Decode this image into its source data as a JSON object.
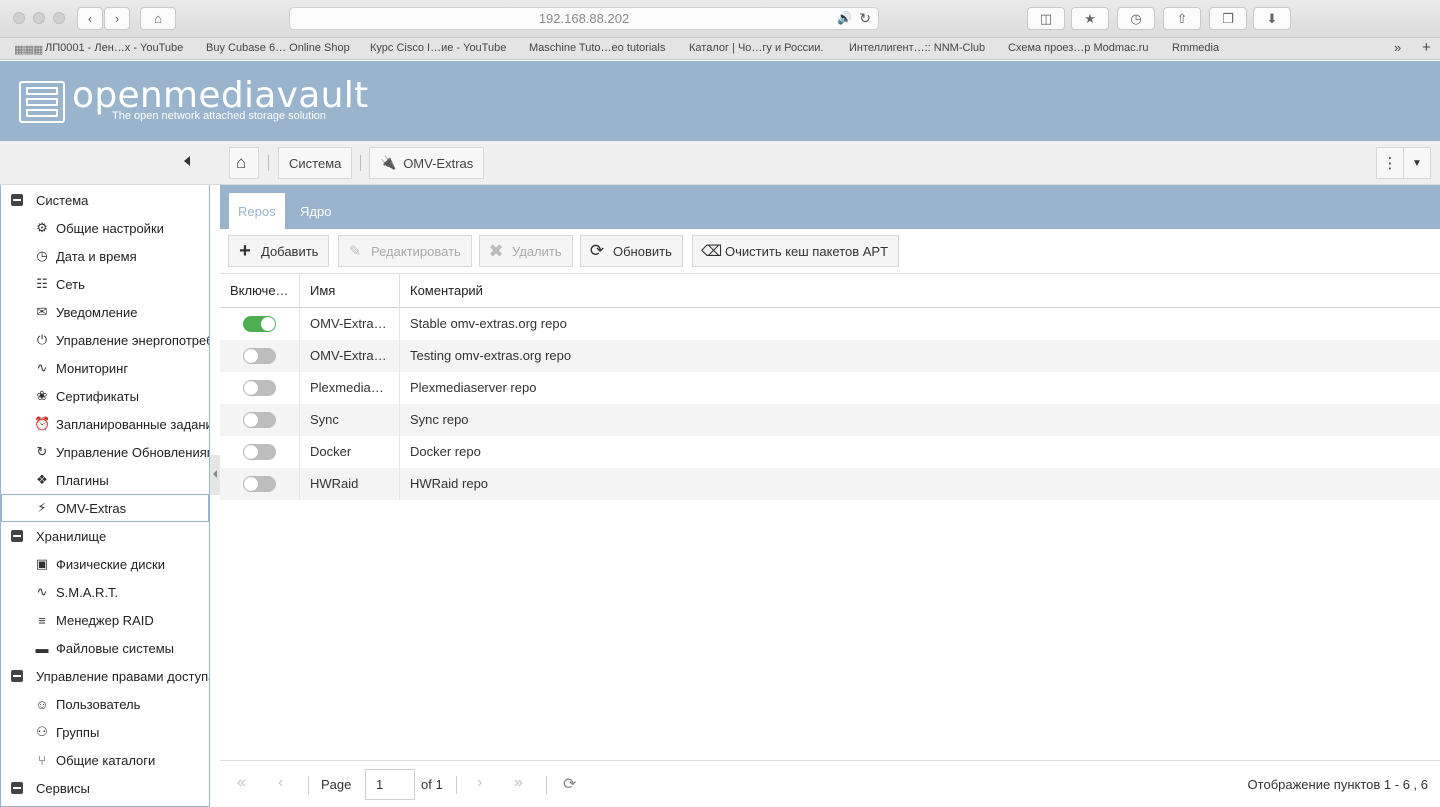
{
  "browser": {
    "address": "192.168.88.202",
    "bookmarks": [
      "ЛП0001 - Лен…х - YouTube",
      "Buy Cubase 6… Online Shop",
      "Курс Cisco I…ие - YouTube",
      "Maschine Tuto…eo tutorials",
      "Каталог | Чо…гу и России.",
      "Интеллигент…:: NNM-Club",
      "Схема проез…р Modmac.ru",
      "Rmmedia"
    ]
  },
  "header": {
    "logo_title": "openmediavault",
    "logo_subtitle": "The open network attached storage solution"
  },
  "breadcrumb": {
    "items": [
      "Система",
      "OMV-Extras"
    ]
  },
  "sidebar": {
    "items": [
      {
        "type": "group",
        "label": "Система"
      },
      {
        "type": "child",
        "icon": "gears-icon",
        "label": "Общие настройки"
      },
      {
        "type": "child",
        "icon": "clock-icon",
        "label": "Дата и время"
      },
      {
        "type": "child",
        "icon": "network-icon",
        "label": "Сеть"
      },
      {
        "type": "child",
        "icon": "envelope-icon",
        "label": "Уведомление"
      },
      {
        "type": "child",
        "icon": "power-icon",
        "label": "Управление энергопотребл"
      },
      {
        "type": "child",
        "icon": "chart-icon",
        "label": "Мониторинг"
      },
      {
        "type": "child",
        "icon": "certificate-icon",
        "label": "Сертификаты"
      },
      {
        "type": "child",
        "icon": "alarm-icon",
        "label": "Запланированные задания"
      },
      {
        "type": "child",
        "icon": "update-icon",
        "label": "Управление Обновлениями"
      },
      {
        "type": "child",
        "icon": "puzzle-icon",
        "label": "Плагины"
      },
      {
        "type": "child",
        "icon": "plug-icon",
        "label": "OMV-Extras",
        "selected": true
      },
      {
        "type": "group",
        "label": "Хранилище"
      },
      {
        "type": "child",
        "icon": "disk-icon",
        "label": "Физические диски"
      },
      {
        "type": "child",
        "icon": "smart-icon",
        "label": "S.M.A.R.T."
      },
      {
        "type": "child",
        "icon": "database-icon",
        "label": "Менеджер RAID"
      },
      {
        "type": "child",
        "icon": "folder-icon",
        "label": "Файловые системы"
      },
      {
        "type": "group",
        "label": "Управление правами доступа"
      },
      {
        "type": "child",
        "icon": "user-icon",
        "label": "Пользователь"
      },
      {
        "type": "child",
        "icon": "users-icon",
        "label": "Группы"
      },
      {
        "type": "child",
        "icon": "share-icon",
        "label": "Общие каталоги"
      },
      {
        "type": "group",
        "label": "Сервисы"
      }
    ]
  },
  "tabs": [
    {
      "label": "Repos",
      "active": true
    },
    {
      "label": "Ядро",
      "active": false
    }
  ],
  "toolbar": {
    "add": "Добавить",
    "edit": "Редактировать",
    "delete": "Удалить",
    "refresh": "Обновить",
    "clear_cache": "Очистить кеш пакетов APT"
  },
  "grid": {
    "columns": [
      "Включе…",
      "Имя",
      "Коментарий"
    ],
    "rows": [
      {
        "enabled": true,
        "name": "OMV-Extra…",
        "comment": "Stable omv-extras.org repo"
      },
      {
        "enabled": false,
        "name": "OMV-Extra…",
        "comment": "Testing omv-extras.org repo"
      },
      {
        "enabled": false,
        "name": "Plexmedia…",
        "comment": "Plexmediaserver repo"
      },
      {
        "enabled": false,
        "name": "Sync",
        "comment": "Sync repo"
      },
      {
        "enabled": false,
        "name": "Docker",
        "comment": "Docker repo"
      },
      {
        "enabled": false,
        "name": "HWRaid",
        "comment": "HWRaid repo"
      }
    ]
  },
  "pager": {
    "page_label": "Page",
    "page_value": "1",
    "of_label": "of 1",
    "display": "Отображение пунктов 1 - 6 , 6"
  },
  "colors": {
    "accent": "#99b4cc",
    "switch_on": "#4caf50"
  }
}
